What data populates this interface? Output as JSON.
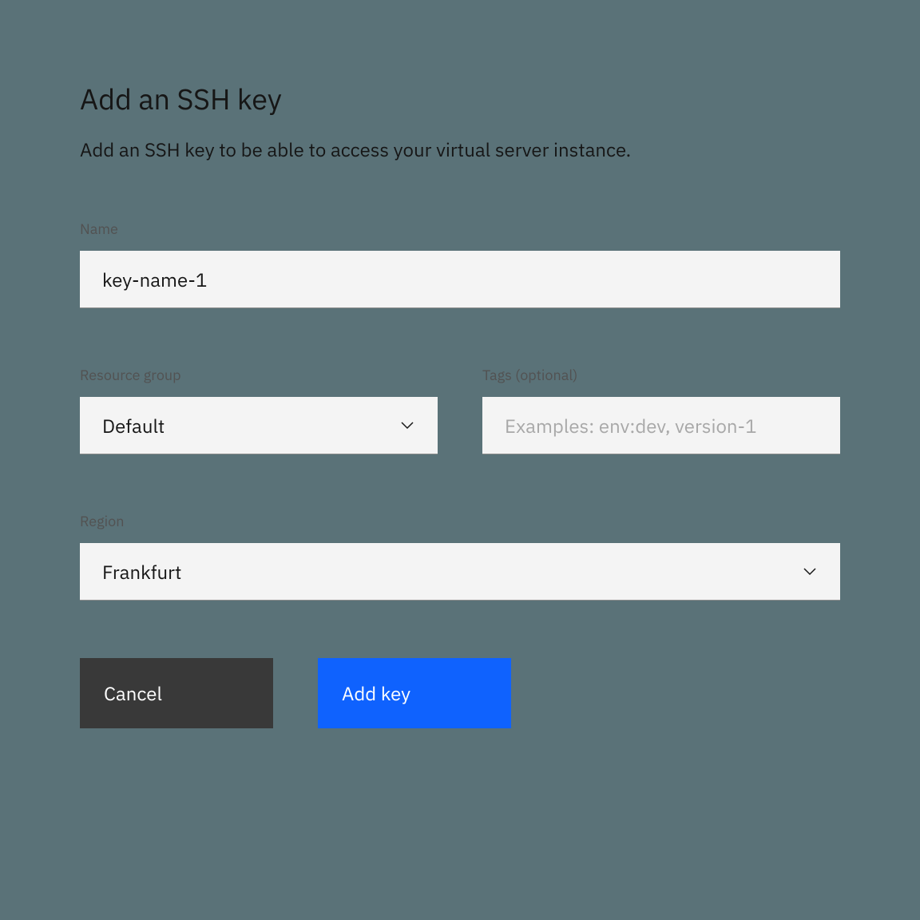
{
  "header": {
    "title": "Add an SSH key",
    "subtitle": "Add an SSH key to be able to access your virtual server instance."
  },
  "fields": {
    "name": {
      "label": "Name",
      "value": "key-name-1"
    },
    "resourceGroup": {
      "label": "Resource group",
      "value": "Default"
    },
    "tags": {
      "label": "Tags (optional)",
      "placeholder": "Examples: env:dev, version-1",
      "value": ""
    },
    "region": {
      "label": "Region",
      "value": "Frankfurt"
    }
  },
  "buttons": {
    "cancel": "Cancel",
    "addKey": "Add key"
  }
}
